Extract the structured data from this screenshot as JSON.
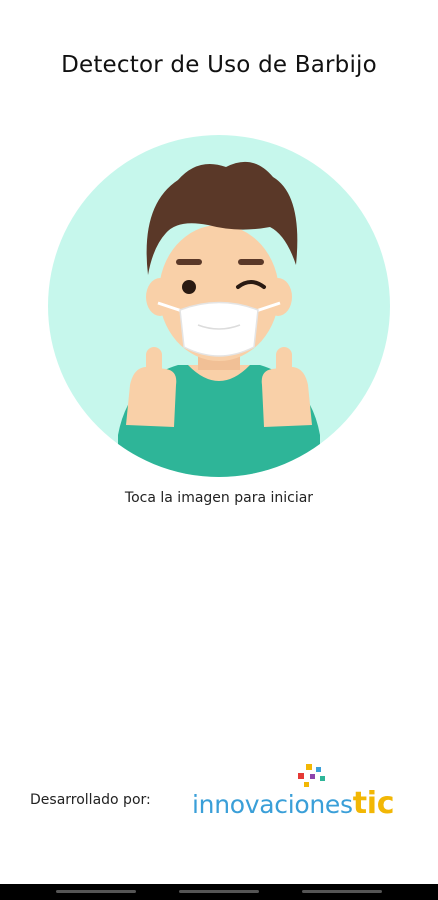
{
  "app": {
    "title": "Detector de Uso de Barbijo"
  },
  "main": {
    "hint": "Toca la imagen para iniciar",
    "illustration_icon": "masked-boy-thumbs-up"
  },
  "footer": {
    "developed_by": "Desarrollado por:",
    "logo_text_a": "innovaciones",
    "logo_text_b": "tic"
  },
  "colors": {
    "circle": "#c6f7ec",
    "shirt": "#2eb598",
    "skin": "#f9d0a8",
    "hair": "#5a3828",
    "logo_blue": "#3a9fd8",
    "logo_yellow": "#f2b705"
  }
}
